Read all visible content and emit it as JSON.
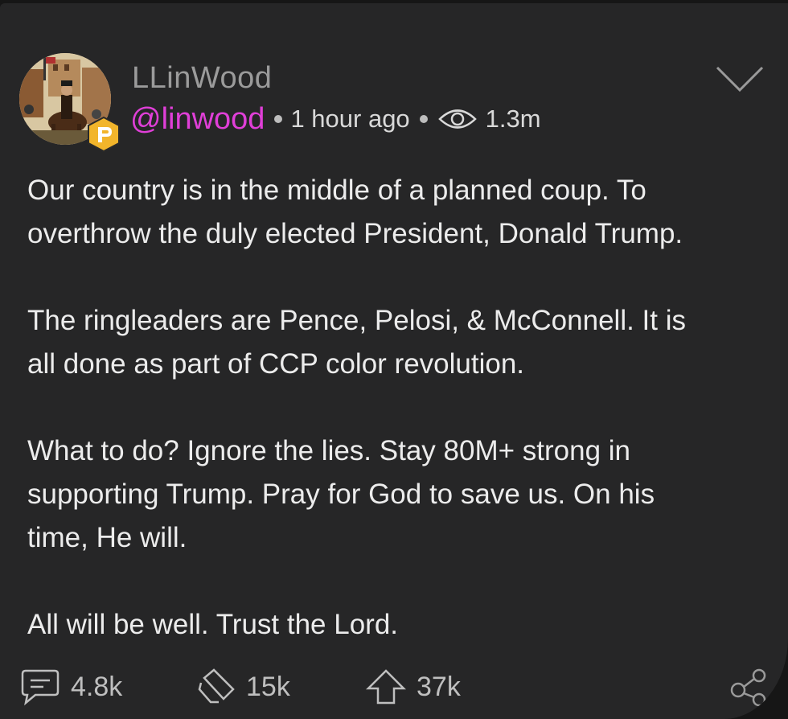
{
  "post": {
    "display_name": "LLinWood",
    "username": "@linwood",
    "time": "1 hour ago",
    "views": "1.3m",
    "paragraphs": [
      "Our country is in the middle of a planned coup. To\noverthrow the duly elected President, Donald Trump.",
      "The ringleaders are Pence, Pelosi, & McConnell. It is\nall done as part of CCP color revolution.",
      "What to do? Ignore the lies. Stay 80M+ strong in\nsupporting Trump. Pray for God to save us. On his\ntime, He will.",
      "All will be well. Trust the Lord."
    ]
  },
  "actions": {
    "comments": "4.8k",
    "echoes": "15k",
    "upvotes": "37k"
  },
  "icons": {
    "verified_badge": "parler-gold-badge",
    "views": "eye-icon",
    "menu": "chevron-down-icon",
    "comment": "comment-icon",
    "echo": "echo-icon",
    "upvote": "upvote-icon",
    "share": "share-icon"
  },
  "colors": {
    "background": "#262627",
    "username": "#e03fd8",
    "badge": "#f2b52b",
    "text": "#ececec",
    "muted": "#9b9b9b"
  }
}
